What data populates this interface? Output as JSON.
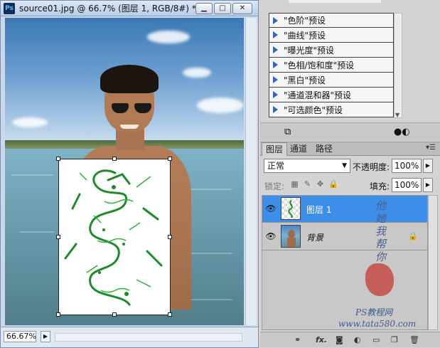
{
  "document": {
    "app_logo": "Ps",
    "title": "source01.jpg @ 66.7% (图层 1, RGB/8#) *",
    "window_buttons": {
      "minimize": "▁",
      "restore": "□",
      "close": "✕"
    },
    "zoom": "66.67%"
  },
  "adjustments": {
    "presets": [
      "\"色阶\"预设",
      "\"曲线\"预设",
      "\"曝光度\"预设",
      "\"色相/饱和度\"预设",
      "\"黑白\"预设",
      "\"通道混和器\"预设",
      "\"可选颜色\"预设"
    ]
  },
  "layers_panel": {
    "tabs": [
      "图层",
      "通道",
      "路径"
    ],
    "active_tab": "图层",
    "blend_mode": "正常",
    "opacity_label": "不透明度:",
    "opacity_value": "100%",
    "lock_label": "锁定:",
    "fill_label": "填充:",
    "fill_value": "100%",
    "layers": [
      {
        "name": "图层 1",
        "selected": true,
        "visible": true
      },
      {
        "name": "背景",
        "selected": false,
        "visible": true,
        "locked": true
      }
    ],
    "footer_icons": [
      "link-icon",
      "fx-icon",
      "mask-icon",
      "adjustment-icon",
      "group-icon",
      "new-layer-icon",
      "trash-icon"
    ]
  },
  "watermark": {
    "vertical_text": "他她我帮你",
    "line1": "PS教程网",
    "line2": "www.tata580.com"
  },
  "colors": {
    "selected_layer": "#3d8ee8",
    "tattoo_green": "#1f8a2a",
    "seal_red": "#c44a44"
  }
}
